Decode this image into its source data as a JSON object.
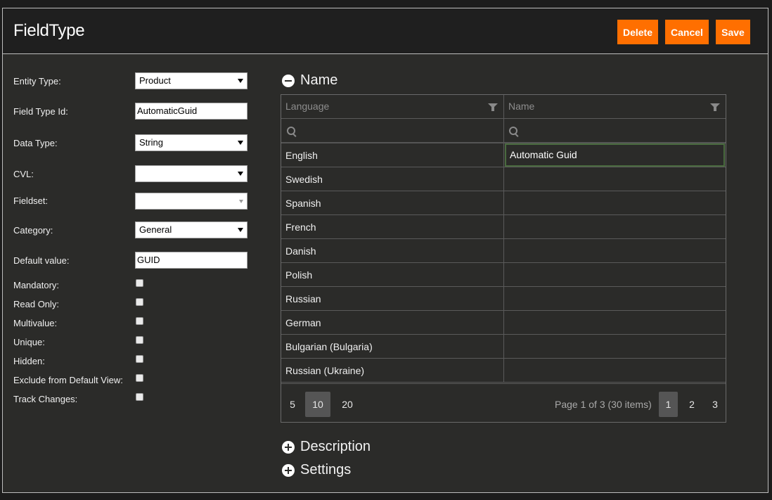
{
  "header": {
    "title": "FieldType",
    "buttons": {
      "delete": "Delete",
      "cancel": "Cancel",
      "save": "Save"
    }
  },
  "form": {
    "entity_type": {
      "label": "Entity Type:",
      "value": "Product"
    },
    "field_type_id": {
      "label": "Field Type Id:",
      "value": "AutomaticGuid"
    },
    "data_type": {
      "label": "Data Type:",
      "value": "String"
    },
    "cvl": {
      "label": "CVL:",
      "value": ""
    },
    "fieldset": {
      "label": "Fieldset:",
      "value": ""
    },
    "category": {
      "label": "Category:",
      "value": "General"
    },
    "default_value": {
      "label": "Default value:",
      "value": "GUID"
    },
    "checkboxes": [
      {
        "label": "Mandatory:",
        "checked": false
      },
      {
        "label": "Read Only:",
        "checked": false
      },
      {
        "label": "Multivalue:",
        "checked": false
      },
      {
        "label": "Unique:",
        "checked": false
      },
      {
        "label": "Hidden:",
        "checked": false
      },
      {
        "label": "Exclude from Default View:",
        "checked": false
      },
      {
        "label": "Track Changes:",
        "checked": false
      }
    ]
  },
  "sections": {
    "name": "Name",
    "description": "Description",
    "settings": "Settings"
  },
  "grid": {
    "columns": [
      "Language",
      "Name"
    ],
    "rows": [
      {
        "language": "English",
        "name": "Automatic Guid"
      },
      {
        "language": "Swedish",
        "name": ""
      },
      {
        "language": "Spanish",
        "name": ""
      },
      {
        "language": "French",
        "name": ""
      },
      {
        "language": "Danish",
        "name": ""
      },
      {
        "language": "Polish",
        "name": ""
      },
      {
        "language": "Russian",
        "name": ""
      },
      {
        "language": "German",
        "name": ""
      },
      {
        "language": "Bulgarian (Bulgaria)",
        "name": ""
      },
      {
        "language": "Russian (Ukraine)",
        "name": ""
      }
    ],
    "pager": {
      "page_sizes": [
        "5",
        "10",
        "20"
      ],
      "selected_page_size": "10",
      "info": "Page 1 of 3 (30 items)",
      "pages": [
        "1",
        "2",
        "3"
      ],
      "current_page": "1"
    }
  },
  "colors": {
    "accent": "#ff6f00",
    "background": "#2b2b29",
    "header": "#1f1f1f"
  }
}
